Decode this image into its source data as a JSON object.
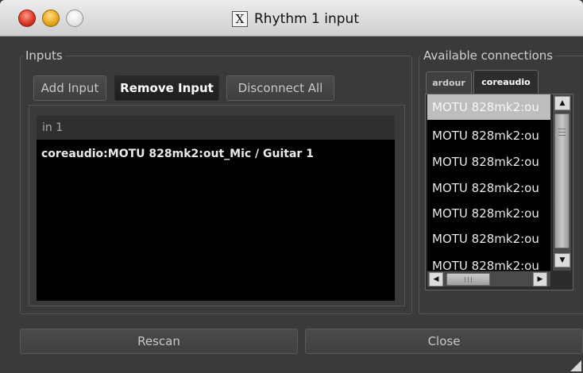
{
  "window": {
    "title": "Rhythm 1 input",
    "title_icon_glyph": "X",
    "controls": [
      "close-button",
      "minimize-button",
      "zoom-button"
    ]
  },
  "inputs": {
    "label": "Inputs",
    "buttons": {
      "add": "Add Input",
      "remove": "Remove Input",
      "disconnect_all": "Disconnect All"
    },
    "port": {
      "name": "in 1",
      "connections": [
        "coreaudio:MOTU 828mk2:out_Mic / Guitar 1"
      ]
    }
  },
  "available": {
    "label": "Available connections",
    "tabs": [
      {
        "label": "ardour",
        "selected": false
      },
      {
        "label": "coreaudio",
        "selected": true
      }
    ],
    "items": [
      "MOTU 828mk2:ou",
      "MOTU 828mk2:ou",
      "MOTU 828mk2:ou",
      "MOTU 828mk2:ou",
      "MOTU 828mk2:ou",
      "MOTU 828mk2:ou",
      "MOTU 828mk2:ou"
    ],
    "selected_index": 0,
    "scroll_icons": {
      "up": "arrow-up-icon",
      "down": "arrow-down-icon",
      "left": "arrow-left-icon",
      "right": "arrow-right-icon"
    }
  },
  "footer": {
    "rescan": "Rescan",
    "close": "Close"
  },
  "colors": {
    "window_bg": "#3a3a3a",
    "list_bg": "#000000",
    "selection_bg": "#bdbdbd"
  }
}
